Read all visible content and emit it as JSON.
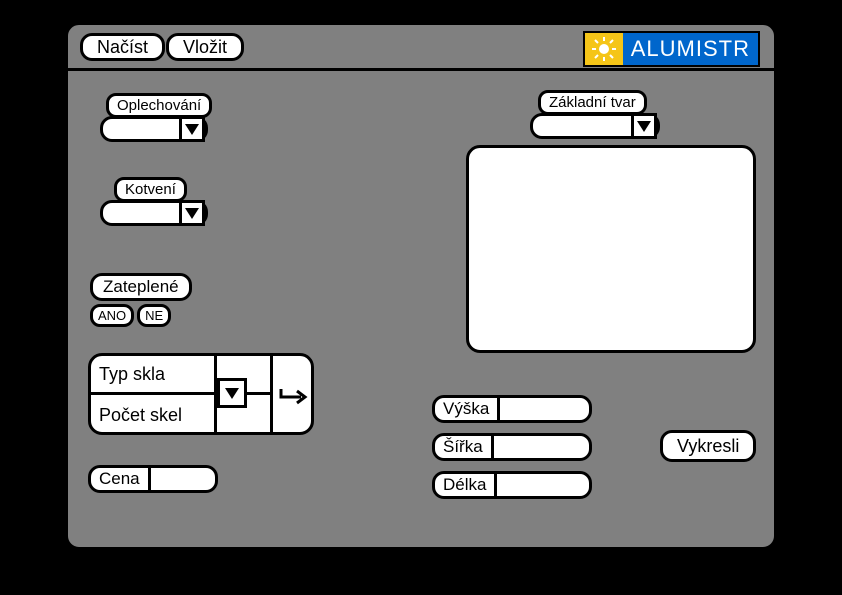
{
  "topbar": {
    "load": "Načíst",
    "insert": "Vložit"
  },
  "brand": "ALUMISTR",
  "left": {
    "oplechovani_label": "Oplechování",
    "kotveni_label": "Kotvení",
    "zateplene_label": "Zateplené",
    "yes": "ANO",
    "no": "NE",
    "typ_skla": "Typ skla",
    "pocet_skel": "Počet skel",
    "cena": "Cena"
  },
  "right": {
    "zakladni_tvar": "Základní tvar",
    "vyska": "Výška",
    "sirka": "Šířka",
    "delka": "Délka",
    "vykresli": "Vykresli"
  }
}
